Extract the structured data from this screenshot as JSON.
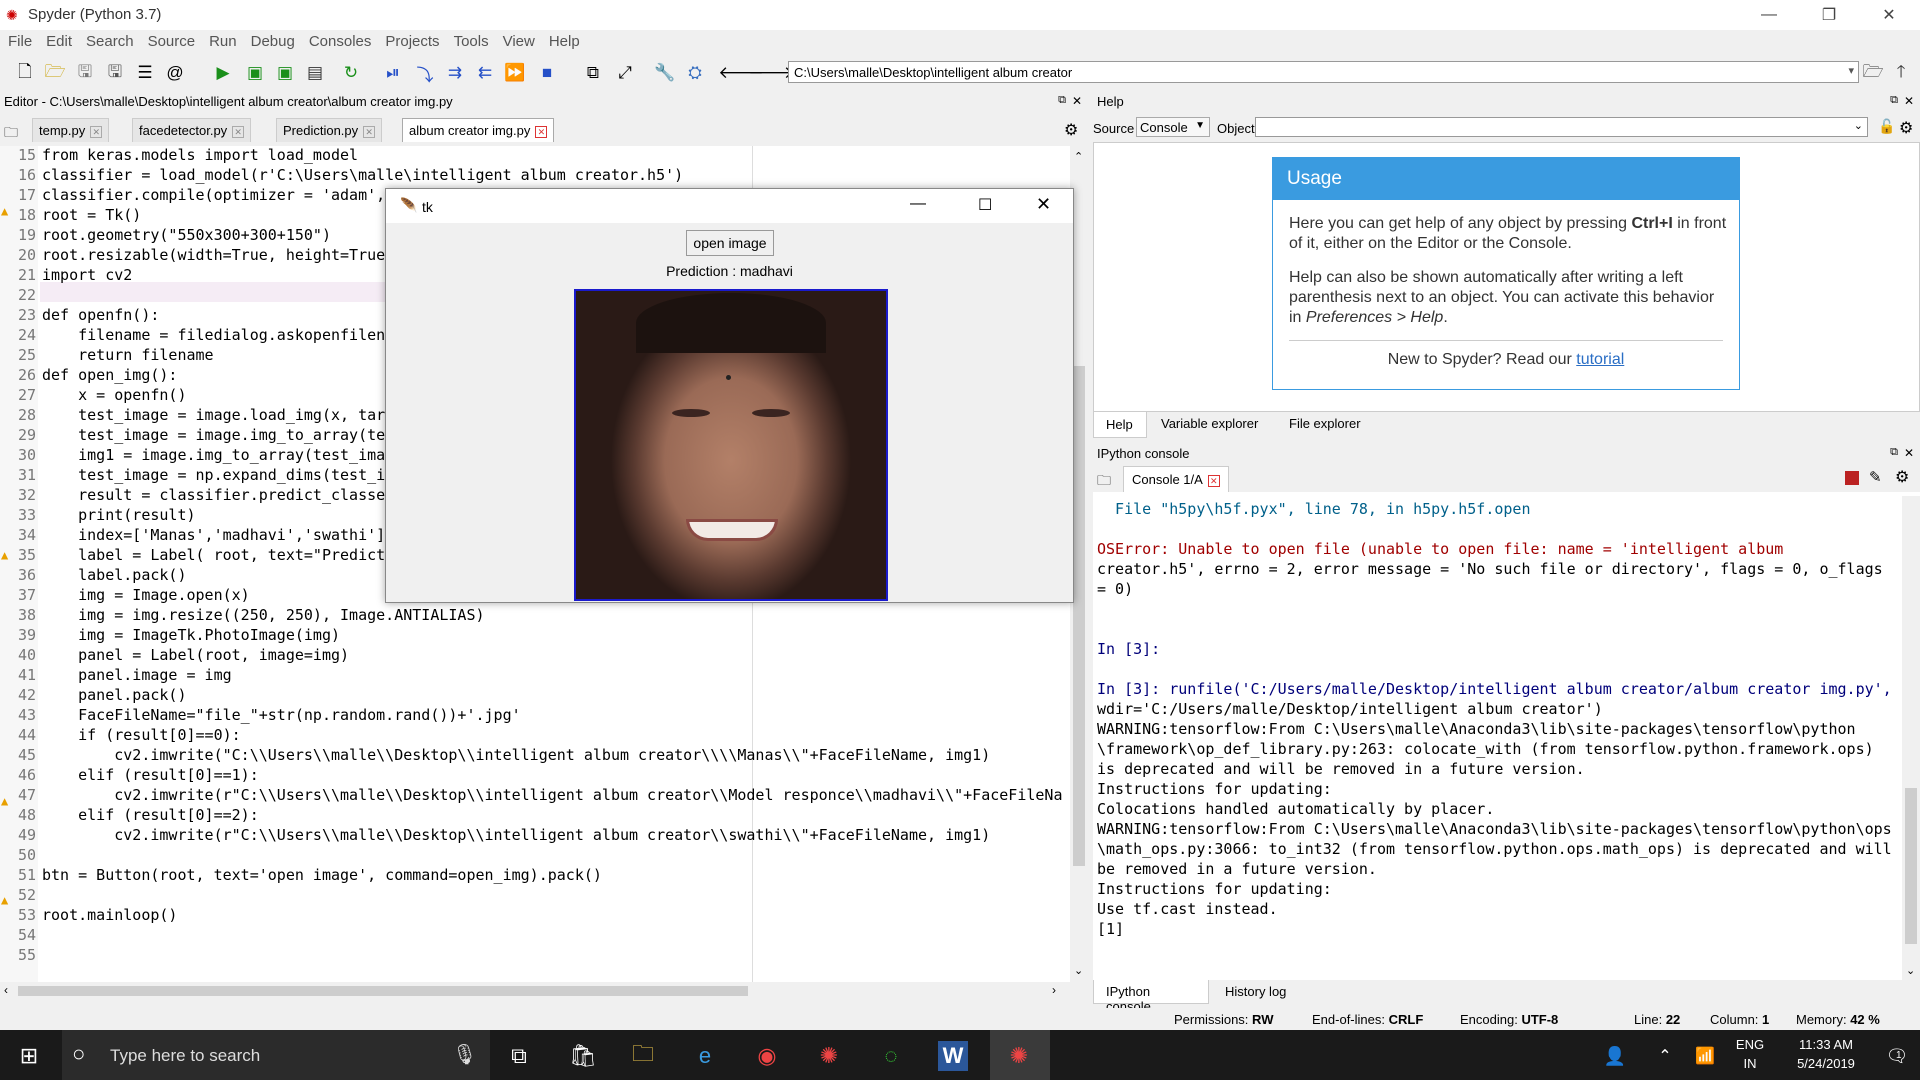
{
  "window": {
    "title": "Spyder (Python 3.7)"
  },
  "menu": [
    "File",
    "Edit",
    "Search",
    "Source",
    "Run",
    "Debug",
    "Consoles",
    "Projects",
    "Tools",
    "View",
    "Help"
  ],
  "toolbar": {
    "path": "C:\\Users\\malle\\Desktop\\intelligent album creator"
  },
  "editor": {
    "title": "Editor - C:\\Users\\malle\\Desktop\\intelligent album creator\\album creator img.py",
    "tabs": [
      "temp.py",
      "facedetector.py",
      "Prediction.py",
      "album creator img.py"
    ],
    "line_numbers": [
      "15",
      "16",
      "17",
      "18",
      "19",
      "20",
      "21",
      "22",
      "23",
      "24",
      "25",
      "26",
      "27",
      "28",
      "29",
      "30",
      "31",
      "32",
      "33",
      "34",
      "35",
      "36",
      "37",
      "38",
      "39",
      "40",
      "41",
      "42",
      "43",
      "44",
      "45",
      "46",
      "47",
      "48",
      "49",
      "50",
      "51",
      "52",
      "53",
      "54",
      "55"
    ],
    "lines": [
      "from keras.models import load_model",
      "classifier = load_model(r'C:\\Users\\malle\\intelligent album creator.h5')",
      "classifier.compile(optimizer = 'adam',",
      "root = Tk()",
      "root.geometry(\"550x300+300+150\")",
      "root.resizable(width=True, height=True",
      "import cv2",
      "",
      "def openfn():",
      "    filename = filedialog.askopenfilen",
      "    return filename",
      "def open_img():",
      "    x = openfn()",
      "    test_image = image.load_img(x, tar",
      "    test_image = image.img_to_array(te",
      "    img1 = image.img_to_array(test_ima",
      "    test_image = np.expand_dims(test_i",
      "    result = classifier.predict_classe",
      "    print(result)",
      "    index=['Manas','madhavi','swathi']",
      "    label = Label( root, text=\"Predict",
      "    label.pack()",
      "    img = Image.open(x)",
      "    img = img.resize((250, 250), Image.ANTIALIAS)",
      "    img = ImageTk.PhotoImage(img)",
      "    panel = Label(root, image=img)",
      "    panel.image = img",
      "    panel.pack()",
      "    FaceFileName=\"file_\"+str(np.random.rand())+'.jpg'",
      "    if (result[0]==0):",
      "        cv2.imwrite(\"C:\\\\Users\\\\malle\\\\Desktop\\\\intelligent album creator\\\\\\\\Manas\\\\\"+FaceFileName, img1)",
      "    elif (result[0]==1):",
      "        cv2.imwrite(r\"C:\\\\Users\\\\malle\\\\Desktop\\\\intelligent album creator\\\\Model responce\\\\madhavi\\\\\"+FaceFileNa",
      "    elif (result[0]==2):",
      "        cv2.imwrite(r\"C:\\\\Users\\\\malle\\\\Desktop\\\\intelligent album creator\\\\swathi\\\\\"+FaceFileName, img1)",
      "",
      "btn = Button(root, text='open image', command=open_img).pack()",
      "",
      "root.mainloop()",
      "",
      ""
    ]
  },
  "tk_window": {
    "title": "tk",
    "button": "open image",
    "prediction": "Prediction : madhavi"
  },
  "help": {
    "title": "Help",
    "source_label": "Source",
    "source_value": "Console",
    "object_label": "Object",
    "usage_title": "Usage",
    "p1_a": "Here you can get help of any object by pressing ",
    "p1_key": "Ctrl+I",
    "p1_b": " in front of it, either on the Editor or the Console.",
    "p2_a": "Help can also be shown automatically after writing a left parenthesis next to an object. You can activate this behavior in ",
    "p2_pref": "Preferences > Help",
    "p2_b": ".",
    "new_text": "New to Spyder? Read our ",
    "tutorial": "tutorial",
    "tabs": [
      "Help",
      "Variable explorer",
      "File explorer"
    ]
  },
  "console": {
    "title": "IPython console",
    "tab": "Console 1/A",
    "lines": [
      "  File \"h5py\\h5f.pyx\", line 78, in h5py.h5f.open",
      "",
      "OSError: Unable to open file (unable to open file: name = 'intelligent album",
      "creator.h5', errno = 2, error message = 'No such file or directory', flags = 0, o_flags",
      "= 0)",
      "",
      "",
      "In [3]:",
      "",
      "In [3]: runfile('C:/Users/malle/Desktop/intelligent album creator/album creator img.py',",
      "wdir='C:/Users/malle/Desktop/intelligent album creator')",
      "WARNING:tensorflow:From C:\\Users\\malle\\Anaconda3\\lib\\site-packages\\tensorflow\\python",
      "\\framework\\op_def_library.py:263: colocate_with (from tensorflow.python.framework.ops)",
      "is deprecated and will be removed in a future version.",
      "Instructions for updating:",
      "Colocations handled automatically by placer.",
      "WARNING:tensorflow:From C:\\Users\\malle\\Anaconda3\\lib\\site-packages\\tensorflow\\python\\ops",
      "\\math_ops.py:3066: to_int32 (from tensorflow.python.ops.math_ops) is deprecated and will",
      "be removed in a future version.",
      "Instructions for updating:",
      "Use tf.cast instead.",
      "[1]"
    ],
    "bottom_tabs": [
      "IPython console",
      "History log"
    ]
  },
  "status": {
    "permissions_label": "Permissions:",
    "permissions": "RW",
    "eol_label": "End-of-lines:",
    "eol": "CRLF",
    "encoding_label": "Encoding:",
    "encoding": "UTF-8",
    "line_label": "Line:",
    "line": "22",
    "column_label": "Column:",
    "column": "1",
    "memory_label": "Memory:",
    "memory": "42 %"
  },
  "taskbar": {
    "search": "Type here to search",
    "lang1": "ENG",
    "lang2": "IN",
    "time": "11:33 AM",
    "date": "5/24/2019",
    "notif": "1"
  }
}
